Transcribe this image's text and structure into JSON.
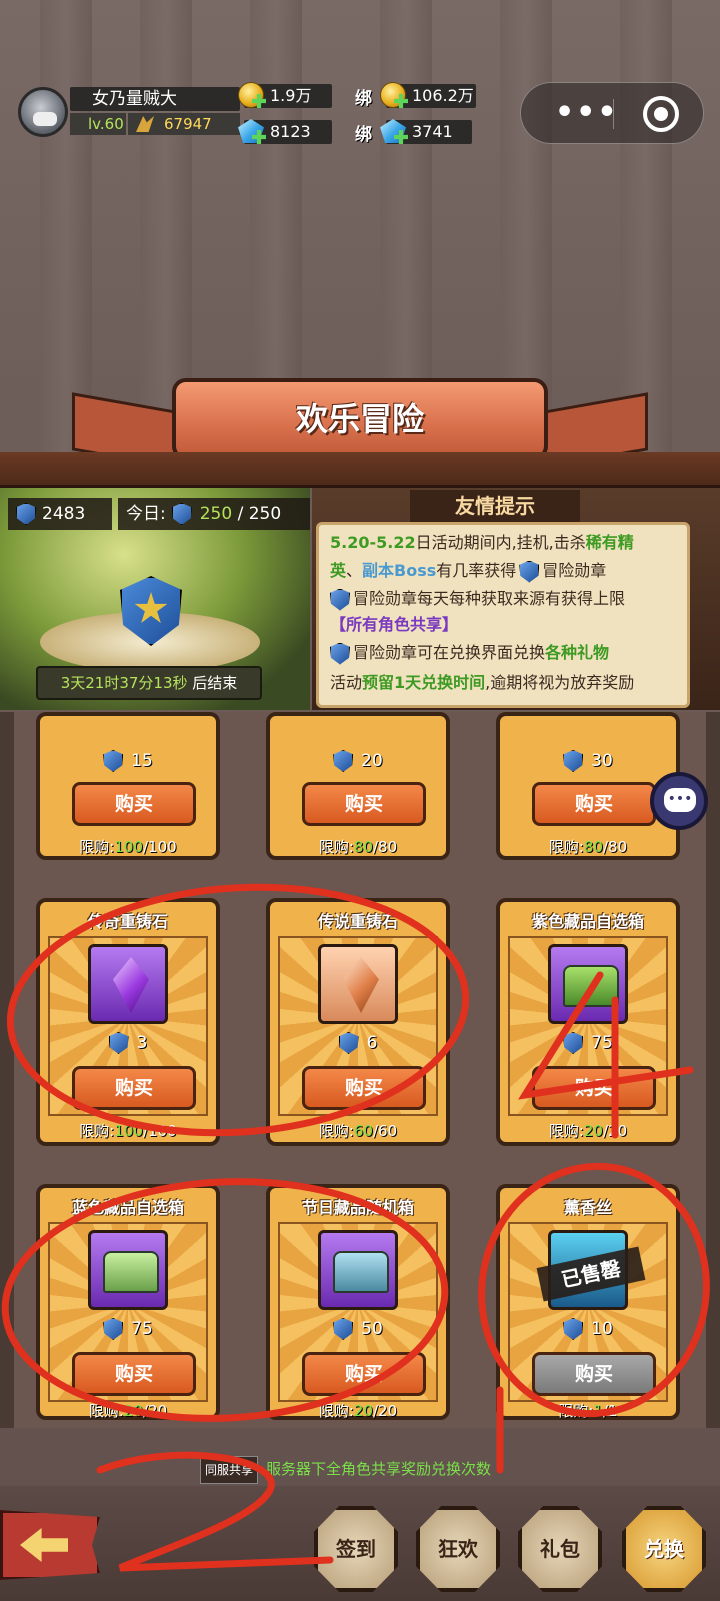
{
  "player": {
    "name": "女乃量贼大",
    "level": "lv.60",
    "power": "67947"
  },
  "currency": {
    "gold": "1.9万",
    "bound_gold_label": "绑",
    "bound_gold": "106.2万",
    "diamond": "8123",
    "bound_diamond_label": "绑",
    "bound_diamond": "3741"
  },
  "banner": {
    "title": "欢乐冒险"
  },
  "event": {
    "medal_total": "2483",
    "today_label": "今日:",
    "today_value": "250",
    "today_sep": "/",
    "today_max": "250",
    "timer_value": "3天21时37分13秒",
    "timer_suffix": "后结束"
  },
  "tips": {
    "title": "友情提示",
    "l1a": "5.20-5.22",
    "l1b": "日活动期间内,挂机,击杀",
    "l1c": "稀有精",
    "l2a": "英",
    "l2b": "、",
    "l2c": "副本Boss",
    "l2d": "有几率获得",
    "l2e": "冒险勋章",
    "l3a": "冒险勋章每天每种获取来源有获得上限",
    "l4a": "【所有角色共享】",
    "l5a": "冒险勋章可在兑换界面兑换",
    "l5b": "各种礼物",
    "l6a": "活动",
    "l6b": "预留1天兑换时间",
    "l6c": ",逾期将视为放弃奖励"
  },
  "shop": {
    "row1": [
      {
        "price": "15",
        "buy": "购买",
        "limit_label": "限购:",
        "limit_used": "100",
        "limit_max": "/100"
      },
      {
        "price": "20",
        "buy": "购买",
        "limit_label": "限购:",
        "limit_used": "80",
        "limit_max": "/80"
      },
      {
        "price": "30",
        "buy": "购买",
        "limit_label": "限购:",
        "limit_used": "80",
        "limit_max": "/80"
      }
    ],
    "row2": [
      {
        "name": "传奇重铸石",
        "price": "3",
        "buy": "购买",
        "limit_label": "限购:",
        "limit_used": "100",
        "limit_max": "/100"
      },
      {
        "name": "传说重铸石",
        "price": "6",
        "buy": "购买",
        "limit_label": "限购:",
        "limit_used": "60",
        "limit_max": "/60"
      },
      {
        "name": "紫色藏品自选箱",
        "price": "75",
        "buy": "购买",
        "limit_label": "限购:",
        "limit_used": "20",
        "limit_max": "/20"
      }
    ],
    "row3": [
      {
        "name": "蓝色藏品自选箱",
        "price": "75",
        "buy": "购买",
        "limit_label": "限购:",
        "limit_used": "20",
        "limit_max": "/20"
      },
      {
        "name": "节日藏品随机箱",
        "price": "50",
        "buy": "购买",
        "limit_label": "限购:",
        "limit_used": "20",
        "limit_max": "/20"
      },
      {
        "name": "薰香丝",
        "price": "10",
        "buy": "购买",
        "soldout": "已售罄",
        "limit_label": "限购:",
        "limit_used": "1",
        "limit_max": "/1"
      }
    ]
  },
  "share": {
    "tag": "同服共享",
    "text": "服务器下全角色共享奖励兑换次数"
  },
  "nav": {
    "sign": "签到",
    "carnival": "狂欢",
    "gift": "礼包",
    "exchange": "兑换"
  },
  "annotations": {
    "a2": "2",
    "a4": "4"
  },
  "colors": {
    "buy_button": "#d85a20",
    "annotation_red": "#e0301e",
    "highlight_green": "#7ae04a"
  }
}
